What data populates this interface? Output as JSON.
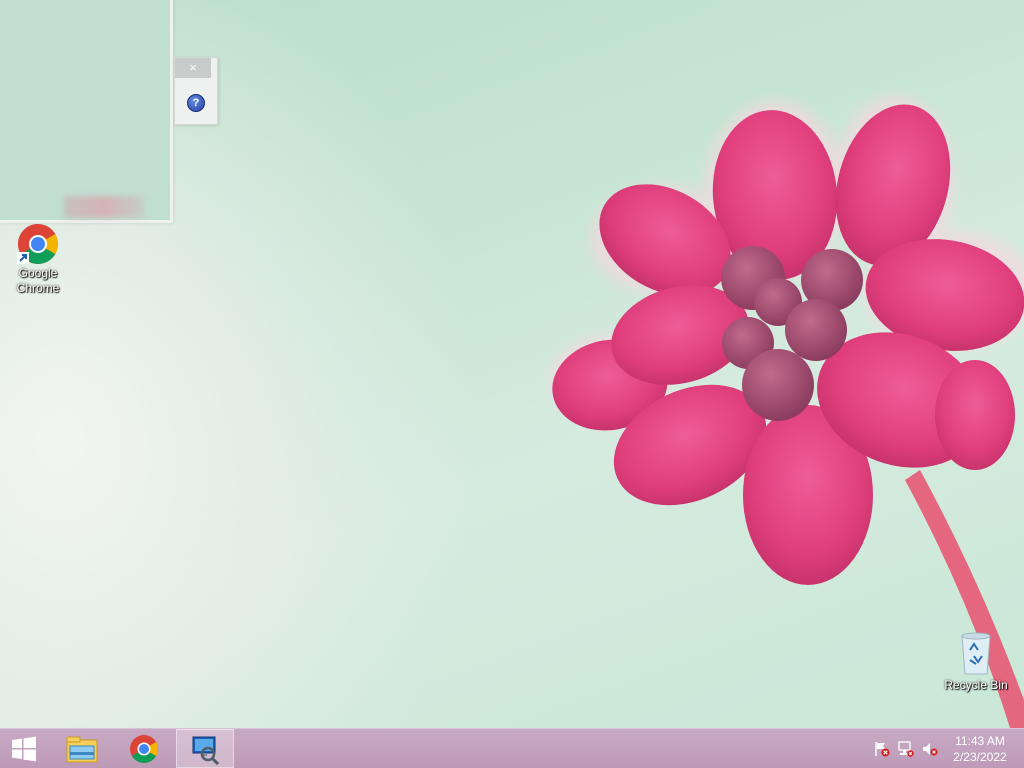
{
  "window": {
    "close_glyph": "×",
    "help_glyph": "?"
  },
  "desktop_icons": [
    {
      "label": "Google Chrome",
      "icon": "chrome-icon"
    },
    {
      "label": "Recycle Bin",
      "icon": "recycle-bin-icon"
    }
  ],
  "taskbar": {
    "start_icon": "windows-logo-icon",
    "pinned": [
      {
        "icon": "file-explorer-icon",
        "active": false
      },
      {
        "icon": "chrome-icon",
        "active": false
      },
      {
        "icon": "network-diagnostics-icon",
        "active": true
      }
    ],
    "tray": [
      {
        "icon": "action-center-flag-icon"
      },
      {
        "icon": "network-icon"
      },
      {
        "icon": "volume-muted-icon"
      }
    ],
    "clock": {
      "time": "11:43 AM",
      "date": "2/23/2022"
    }
  },
  "colors": {
    "taskbar": "#bd9bb8",
    "wallpaper_bg": "#c7e5d3",
    "flower": "#e0447f"
  }
}
